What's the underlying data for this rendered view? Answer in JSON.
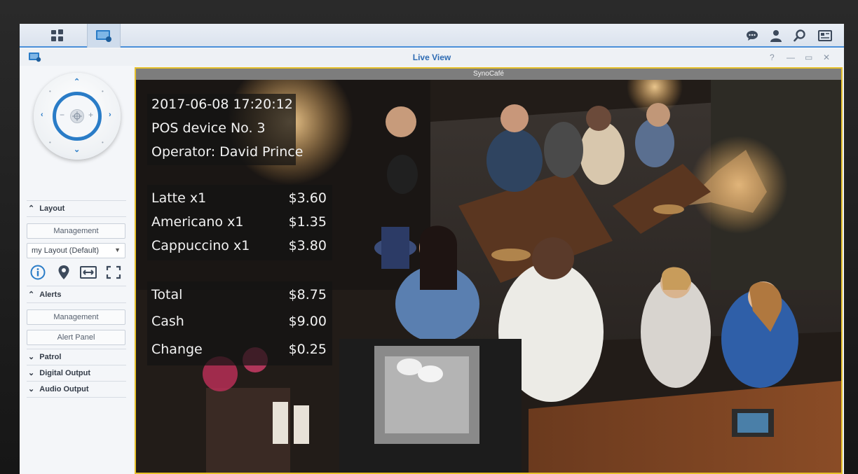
{
  "window": {
    "title": "Live View",
    "help": "?",
    "minimize": "—",
    "restore": "▭",
    "close": "✕"
  },
  "sidebar": {
    "layout_header": "Layout",
    "layout_management": "Management",
    "layout_select": "my Layout (Default)",
    "alerts_header": "Alerts",
    "alerts_management": "Management",
    "alert_panel": "Alert Panel",
    "patrol_header": "Patrol",
    "digital_output_header": "Digital Output",
    "audio_output_header": "Audio Output"
  },
  "camera": {
    "name": "SynoCafé",
    "overlay": {
      "timestamp": "2017-06-08 17:20:12",
      "device": "POS device No. 3",
      "operator": "Operator:  David Prince",
      "items": [
        {
          "name": "Latte x1",
          "price": "$3.60"
        },
        {
          "name": "Americano x1",
          "price": "$1.35"
        },
        {
          "name": "Cappuccino x1",
          "price": "$3.80"
        }
      ],
      "total_label": "Total",
      "total_value": "$8.75",
      "cash_label": "Cash",
      "cash_value": "$9.00",
      "change_label": "Change",
      "change_value": "$0.25"
    }
  },
  "colors": {
    "accent": "#2a7cc7",
    "frame_highlight": "#e6c02a",
    "title_blue": "#2d6bb3"
  }
}
